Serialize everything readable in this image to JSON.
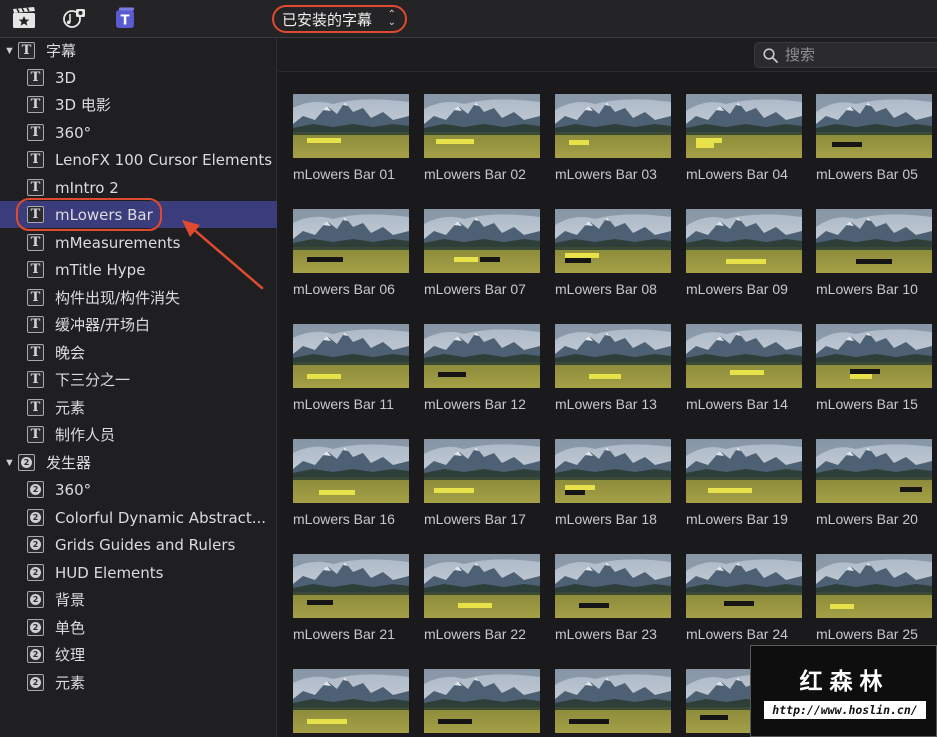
{
  "toolbar": {
    "icons": [
      "clapperboard-star-icon",
      "music-photo-icon",
      "titles-icon"
    ],
    "browser_selector": "已安装的字幕",
    "selector_chevron": "⌃⌄"
  },
  "sidebar": {
    "categories": [
      {
        "label": "字幕",
        "icon": "title-t-icon",
        "expanded": true,
        "items": [
          {
            "label": "3D"
          },
          {
            "label": "3D 电影"
          },
          {
            "label": "360°"
          },
          {
            "label": "LenoFX 100 Cursor Elements"
          },
          {
            "label": "mIntro 2"
          },
          {
            "label": "mLowers Bar",
            "selected": true
          },
          {
            "label": "mMeasurements"
          },
          {
            "label": "mTitle Hype"
          },
          {
            "label": "构件出现/构件消失"
          },
          {
            "label": "缓冲器/开场白"
          },
          {
            "label": "晚会"
          },
          {
            "label": "下三分之一"
          },
          {
            "label": "元素"
          },
          {
            "label": "制作人员"
          }
        ]
      },
      {
        "label": "发生器",
        "icon": "generator-icon",
        "expanded": true,
        "items": [
          {
            "label": "360°"
          },
          {
            "label": "Colorful Dynamic Abstract..."
          },
          {
            "label": "Grids Guides and Rulers"
          },
          {
            "label": "HUD Elements"
          },
          {
            "label": "背景"
          },
          {
            "label": "单色"
          },
          {
            "label": "纹理"
          },
          {
            "label": "元素"
          }
        ]
      }
    ]
  },
  "search": {
    "placeholder": "搜索",
    "value": ""
  },
  "grid": {
    "items": [
      "mLowers Bar 01",
      "mLowers Bar 02",
      "mLowers Bar 03",
      "mLowers Bar 04",
      "mLowers Bar 05",
      "mLowers Bar 06",
      "mLowers Bar 07",
      "mLowers Bar 08",
      "mLowers Bar 09",
      "mLowers Bar 10",
      "mLowers Bar 11",
      "mLowers Bar 12",
      "mLowers Bar 13",
      "mLowers Bar 14",
      "mLowers Bar 15",
      "mLowers Bar 16",
      "mLowers Bar 17",
      "mLowers Bar 18",
      "mLowers Bar 19",
      "mLowers Bar 20",
      "mLowers Bar 21",
      "mLowers Bar 22",
      "mLowers Bar 23",
      "mLowers Bar 24",
      "mLowers Bar 25",
      "",
      "",
      "",
      "",
      ""
    ]
  },
  "watermark": {
    "title": "红森林",
    "url": "http://www.hoslin.cn/"
  },
  "colors": {
    "accent_highlight": "#e04a2f",
    "selection": "#3b3c7c",
    "lower_third_bar": "#e8e24a"
  }
}
